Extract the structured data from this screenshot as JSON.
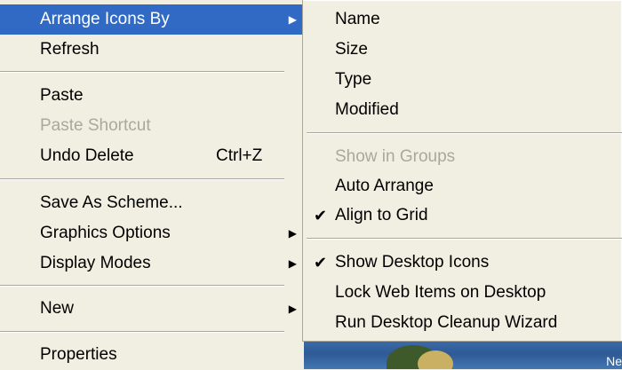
{
  "main_menu": {
    "items": [
      {
        "label": "Arrange Icons By",
        "submenu_arrow": "▶",
        "state": "highlighted"
      },
      {
        "label": "Refresh"
      },
      {
        "label": "Paste"
      },
      {
        "label": "Paste Shortcut",
        "state": "disabled"
      },
      {
        "label": "Undo Delete",
        "shortcut": "Ctrl+Z"
      },
      {
        "label": "Save As Scheme..."
      },
      {
        "label": "Graphics Options",
        "submenu_arrow": "▶"
      },
      {
        "label": "Display Modes",
        "submenu_arrow": "▶"
      },
      {
        "label": "New",
        "submenu_arrow": "▶"
      },
      {
        "label": "Properties"
      }
    ]
  },
  "arrange_submenu": {
    "items": [
      {
        "label": "Name"
      },
      {
        "label": "Size"
      },
      {
        "label": "Type"
      },
      {
        "label": "Modified"
      },
      {
        "label": "Show in Groups",
        "state": "disabled"
      },
      {
        "label": "Auto Arrange"
      },
      {
        "label": "Align to Grid",
        "check": "✔"
      },
      {
        "label": "Show Desktop Icons",
        "check": "✔"
      },
      {
        "label": "Lock Web Items on Desktop"
      },
      {
        "label": "Run Desktop Cleanup Wizard"
      }
    ]
  },
  "desktop": {
    "corner_text": "Ne"
  },
  "colors": {
    "menu_bg": "#f1efe2",
    "highlight_bg": "#316ac5",
    "disabled_text": "#aca899",
    "separator": "#aca899"
  }
}
